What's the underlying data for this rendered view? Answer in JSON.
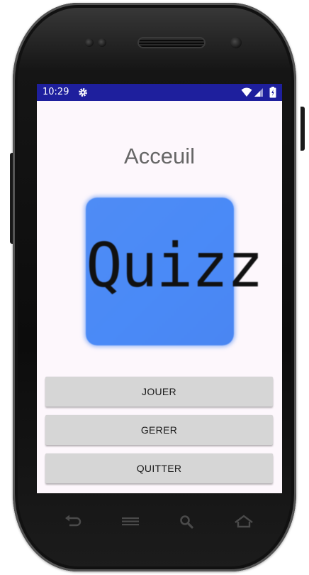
{
  "status_bar": {
    "time": "10:29",
    "background_color": "#1e1f9d",
    "icons": [
      "gear-icon",
      "wifi-icon",
      "signal-icon",
      "battery-icon"
    ]
  },
  "page": {
    "title": "Acceuil",
    "logo_text": "Quizz",
    "logo_color": "#4a8af7"
  },
  "buttons": {
    "play": "JOUER",
    "manage": "GERER",
    "quit": "QUITTER",
    "button_color": "#d6d6d6"
  },
  "nav_bar": {
    "icons": [
      "back-icon",
      "menu-icon",
      "search-icon",
      "home-icon"
    ]
  }
}
